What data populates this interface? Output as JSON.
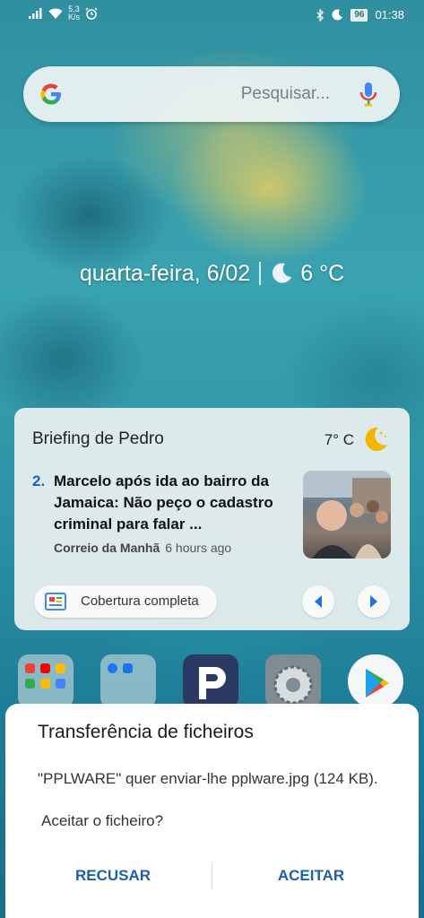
{
  "status_bar": {
    "network_speed_value": "5,3",
    "network_speed_unit": "K/s",
    "battery_level": "96",
    "time": "01:38"
  },
  "search": {
    "placeholder": "Pesquisar..."
  },
  "date_weather": {
    "date": "quarta-feira, 6/02",
    "temperature": "6 °C"
  },
  "briefing": {
    "title": "Briefing de Pedro",
    "temperature": "7° C",
    "news_number": "2.",
    "headline": "Marcelo após ida ao bairro da Jamaica: Não peço o cadastro criminal para falar ...",
    "source": "Correio da Manhã",
    "time_ago": "6 hours ago",
    "coverage_label": "Cobertura completa"
  },
  "dialog": {
    "title": "Transferência de ficheiros",
    "message": "\"PPLWARE\" quer enviar-lhe pplware.jpg (124 KB).",
    "question": "Aceitar o ficheiro?",
    "decline_label": "RECUSAR",
    "accept_label": "ACEITAR"
  },
  "colors": {
    "accent": "#1f5fa8",
    "news_number": "#1a5fc9"
  }
}
